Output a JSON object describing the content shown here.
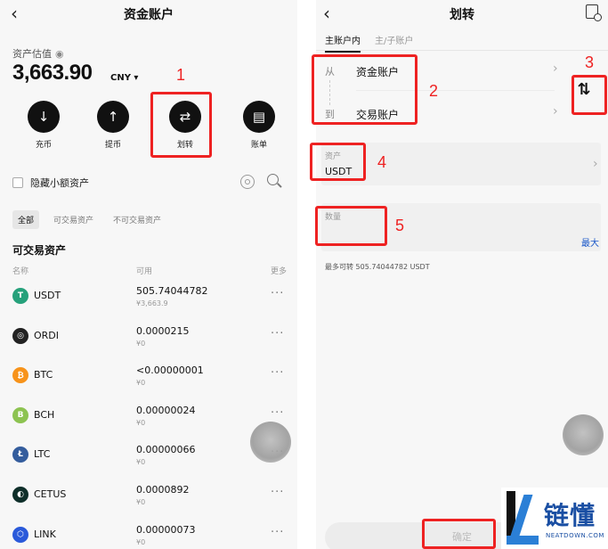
{
  "left_screen": {
    "title": "资金账户",
    "back_glyph": "‹",
    "asset_label": "资产估值",
    "total_value": "3,663.90",
    "currency": "CNY ▾",
    "actions": [
      {
        "label": "充币",
        "icon": "deposit-icon",
        "glyph": "↓"
      },
      {
        "label": "提币",
        "icon": "withdraw-icon",
        "glyph": "↑"
      },
      {
        "label": "划转",
        "icon": "transfer-icon",
        "glyph": "⇄"
      },
      {
        "label": "账单",
        "icon": "bill-icon",
        "glyph": "▤"
      }
    ],
    "hide_small_label": "隐藏小额资产",
    "filters": [
      "全部",
      "可交易资产",
      "不可交易资产"
    ],
    "section_title": "可交易资产",
    "columns": {
      "name": "名称",
      "available": "可用",
      "more": "更多"
    },
    "coins": [
      {
        "symbol": "USDT",
        "amount": "505.74044782",
        "value": "¥3,663.9",
        "icon_color": "#26a17b",
        "glyph": "T"
      },
      {
        "symbol": "ORDI",
        "amount": "0.0000215",
        "value": "¥0",
        "icon_color": "#222222",
        "glyph": "◎"
      },
      {
        "symbol": "BTC",
        "amount": "<0.00000001",
        "value": "¥0",
        "icon_color": "#f7931a",
        "glyph": "₿"
      },
      {
        "symbol": "BCH",
        "amount": "0.00000024",
        "value": "¥0",
        "icon_color": "#8dc351",
        "glyph": "B"
      },
      {
        "symbol": "LTC",
        "amount": "0.00000066",
        "value": "¥0",
        "icon_color": "#345d9d",
        "glyph": "Ł"
      },
      {
        "symbol": "CETUS",
        "amount": "0.0000892",
        "value": "¥0",
        "icon_color": "#0f2f2a",
        "glyph": "◐"
      },
      {
        "symbol": "LINK",
        "amount": "0.00000073",
        "value": "¥0",
        "icon_color": "#2a5ada",
        "glyph": "⬡"
      }
    ],
    "more_glyph": "···"
  },
  "right_screen": {
    "title": "划转",
    "back_glyph": "‹",
    "tabs": [
      "主账户内",
      "主/子账户"
    ],
    "from_label": "从",
    "from_value": "资金账户",
    "to_label": "到",
    "to_value": "交易账户",
    "swap_glyph": "⇅",
    "chevron": "›",
    "asset_label": "资产",
    "asset_value": "USDT",
    "quantity_label": "数量",
    "max_label": "最大",
    "max_available": "最多可转 505.74044782 USDT",
    "confirm_label": "确定"
  },
  "annotations": [
    "1",
    "2",
    "3",
    "4",
    "5"
  ],
  "logo": {
    "text": "链懂",
    "sub": "NEATDOWN.COM"
  },
  "colors": {
    "annotation": "#ee2222",
    "accent_link": "#1a57c9",
    "logo_blue": "#1a4fa3"
  }
}
